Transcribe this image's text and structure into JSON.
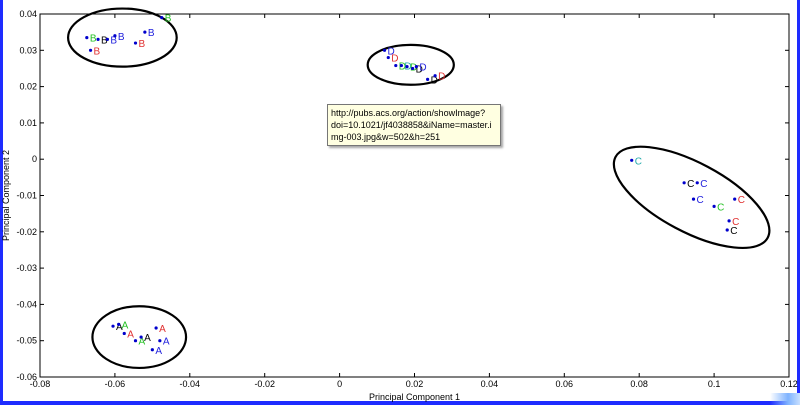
{
  "chart_data": {
    "type": "scatter",
    "title": "",
    "xlabel": "Principal Component 1",
    "ylabel": "Principal Component 2",
    "xlim": [
      -0.08,
      0.12
    ],
    "ylim": [
      -0.06,
      0.04
    ],
    "xticks": [
      "-0.08",
      "-0.06",
      "-0.04",
      "-0.02",
      "0",
      "0.02",
      "0.04",
      "0.06",
      "0.08",
      "0.1",
      "0.12"
    ],
    "yticks": [
      "0.04",
      "0.03",
      "0.02",
      "0.01",
      "0",
      "-0.01",
      "-0.02",
      "-0.03",
      "-0.04",
      "-0.05",
      "-0.06"
    ],
    "grid": false,
    "colors": {
      "blue": "#2222dd",
      "red": "#e03030",
      "green": "#22c022",
      "black": "#000000",
      "cyan": "#22aaaa",
      "dot": "#0000cc"
    },
    "points": [
      {
        "x": -0.0675,
        "y": 0.0335,
        "label": "B",
        "color": "green"
      },
      {
        "x": -0.0665,
        "y": 0.03,
        "label": "B",
        "color": "red"
      },
      {
        "x": -0.0645,
        "y": 0.033,
        "label": "B",
        "color": "black"
      },
      {
        "x": -0.062,
        "y": 0.033,
        "label": "B",
        "color": "blue"
      },
      {
        "x": -0.06,
        "y": 0.034,
        "label": "B",
        "color": "blue"
      },
      {
        "x": -0.0545,
        "y": 0.032,
        "label": "B",
        "color": "red"
      },
      {
        "x": -0.052,
        "y": 0.035,
        "label": "B",
        "color": "blue"
      },
      {
        "x": -0.0475,
        "y": 0.039,
        "label": "B",
        "color": "green"
      },
      {
        "x": 0.012,
        "y": 0.03,
        "label": "D",
        "color": "blue"
      },
      {
        "x": 0.013,
        "y": 0.028,
        "label": "D",
        "color": "red"
      },
      {
        "x": 0.015,
        "y": 0.0258,
        "label": "D",
        "color": "green"
      },
      {
        "x": 0.0165,
        "y": 0.0258,
        "label": "D",
        "color": "cyan"
      },
      {
        "x": 0.018,
        "y": 0.0255,
        "label": "D",
        "color": "green"
      },
      {
        "x": 0.0195,
        "y": 0.025,
        "label": "D",
        "color": "black"
      },
      {
        "x": 0.0205,
        "y": 0.0255,
        "label": "D",
        "color": "blue"
      },
      {
        "x": 0.0235,
        "y": 0.022,
        "label": "D",
        "color": "black"
      },
      {
        "x": 0.0255,
        "y": 0.023,
        "label": "D",
        "color": "red"
      },
      {
        "x": 0.078,
        "y": -0.0003,
        "label": "C",
        "color": "cyan"
      },
      {
        "x": 0.092,
        "y": -0.0065,
        "label": "C",
        "color": "black"
      },
      {
        "x": 0.0955,
        "y": -0.0065,
        "label": "C",
        "color": "blue"
      },
      {
        "x": 0.0945,
        "y": -0.011,
        "label": "C",
        "color": "blue"
      },
      {
        "x": 0.1,
        "y": -0.013,
        "label": "C",
        "color": "green"
      },
      {
        "x": 0.1055,
        "y": -0.011,
        "label": "C",
        "color": "red"
      },
      {
        "x": 0.104,
        "y": -0.017,
        "label": "C",
        "color": "red"
      },
      {
        "x": 0.1035,
        "y": -0.0195,
        "label": "C",
        "color": "black"
      },
      {
        "x": -0.0605,
        "y": -0.046,
        "label": "A",
        "color": "black"
      },
      {
        "x": -0.059,
        "y": -0.0455,
        "label": "A",
        "color": "green"
      },
      {
        "x": -0.0575,
        "y": -0.048,
        "label": "A",
        "color": "red"
      },
      {
        "x": -0.0545,
        "y": -0.05,
        "label": "A",
        "color": "green"
      },
      {
        "x": -0.053,
        "y": -0.049,
        "label": "A",
        "color": "black"
      },
      {
        "x": -0.049,
        "y": -0.0465,
        "label": "A",
        "color": "red"
      },
      {
        "x": -0.048,
        "y": -0.05,
        "label": "A",
        "color": "blue"
      },
      {
        "x": -0.05,
        "y": -0.0525,
        "label": "A",
        "color": "blue"
      }
    ],
    "ellipses": [
      {
        "name": "group-b",
        "cx": -0.058,
        "cy": 0.0335,
        "rx": 0.0145,
        "ry": 0.008,
        "rot": 0
      },
      {
        "name": "group-d",
        "cx": 0.019,
        "cy": 0.026,
        "rx": 0.0115,
        "ry": 0.0055,
        "rot": 0
      },
      {
        "name": "group-c",
        "cx": 0.094,
        "cy": -0.0105,
        "rx": 0.023,
        "ry": 0.0095,
        "rot": 28
      },
      {
        "name": "group-a",
        "cx": -0.0535,
        "cy": -0.049,
        "rx": 0.0125,
        "ry": 0.0085,
        "rot": 0
      }
    ]
  },
  "tooltip": {
    "lines": [
      "http://pubs.acs.org/action/showImage?",
      "doi=10.1021/jf4038858&iName=master.i",
      "mg-003.jpg&w=502&h=251"
    ]
  }
}
